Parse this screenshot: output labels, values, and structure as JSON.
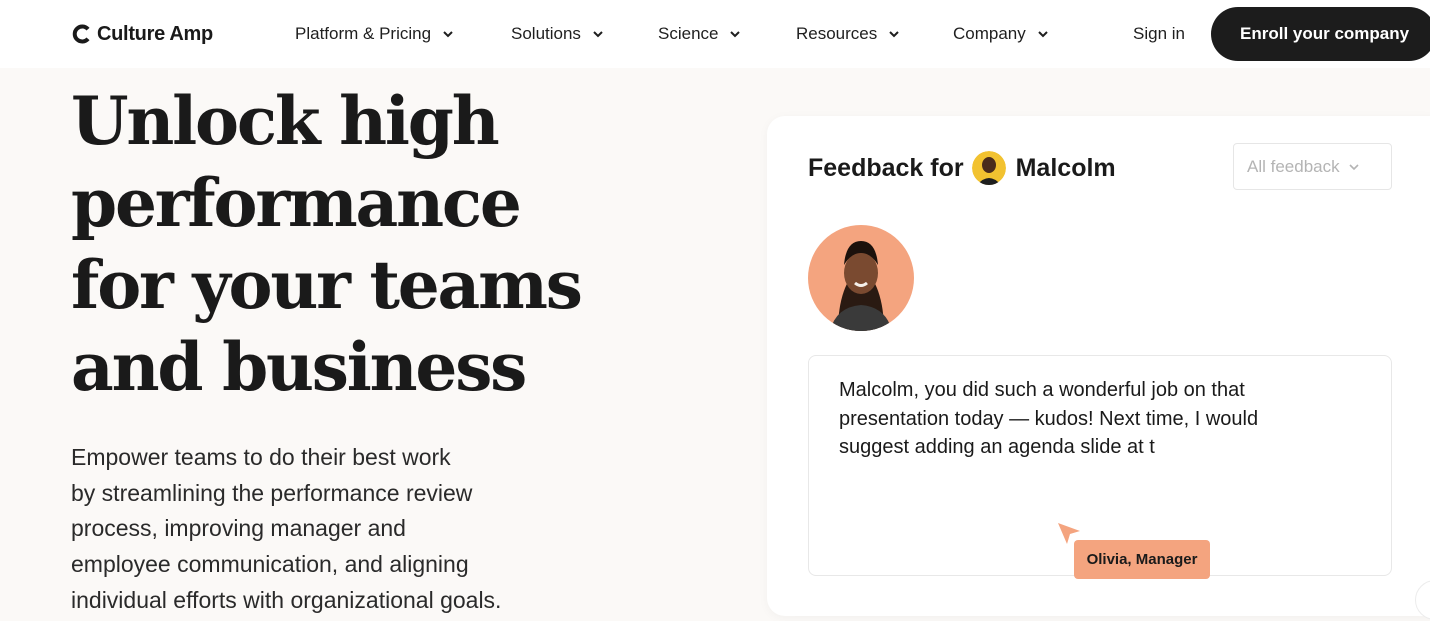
{
  "header": {
    "brand": "Culture Amp",
    "nav": [
      {
        "label": "Platform & Pricing"
      },
      {
        "label": "Solutions"
      },
      {
        "label": "Science"
      },
      {
        "label": "Resources"
      },
      {
        "label": "Company"
      }
    ],
    "sign_in": "Sign in",
    "cta": "Enroll your company"
  },
  "hero": {
    "title_lines": [
      "Unlock high",
      "performance",
      "for your teams",
      "and business"
    ],
    "subtitle_lines": [
      "Empower teams to do their best work",
      "by streamlining the performance review",
      "process, improving manager and",
      "employee communication, and aligning",
      "individual efforts with organizational goals."
    ]
  },
  "card": {
    "title_prefix": "Feedback for",
    "recipient": "Malcolm",
    "filter_value": "All feedback",
    "feedback_lines": [
      "Malcolm, you did such a wonderful job on that",
      "presentation today — kudos! Next time, I would",
      "suggest adding an agenda slide at t"
    ],
    "author": "Olivia, Manager"
  },
  "colors": {
    "accent": "#f4a47f",
    "cta_bg": "#1c1c1c",
    "page_bg": "#fbf9f7"
  },
  "icons": [
    "culture-amp-logo-icon",
    "chevron-down-icon",
    "cursor-pointer-icon"
  ]
}
